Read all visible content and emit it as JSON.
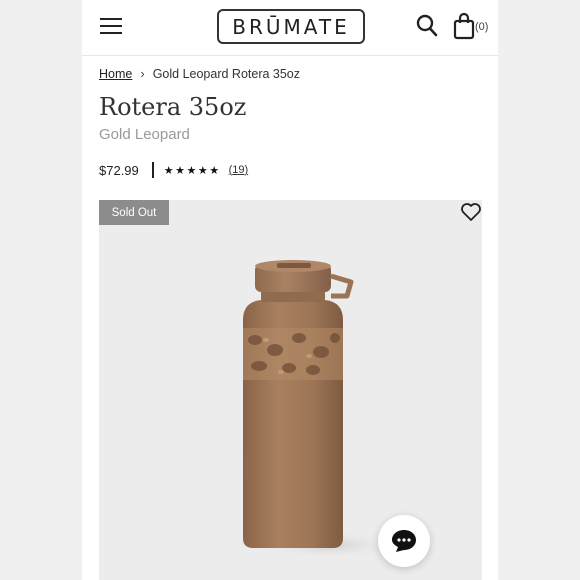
{
  "header": {
    "logo_text": "BRŪMATE",
    "cart_count": "(0)"
  },
  "breadcrumb": {
    "home_label": "Home",
    "separator": "›",
    "current": "Gold Leopard Rotera 35oz"
  },
  "product": {
    "title": "Rotera 35oz",
    "variant": "Gold Leopard",
    "price": "$72.99",
    "rating": 5,
    "stars": "★★★★★",
    "review_count": "19",
    "badge": "Sold Out"
  },
  "colors": {
    "accent": "#8c8c8c",
    "bottle_body": "#a0785a",
    "bottle_lid": "#9b7457"
  },
  "icons": {
    "menu": "hamburger-menu-icon",
    "search": "search-icon",
    "cart": "shopping-bag-icon",
    "wishlist": "heart-icon",
    "chat": "chat-bubble-icon"
  }
}
